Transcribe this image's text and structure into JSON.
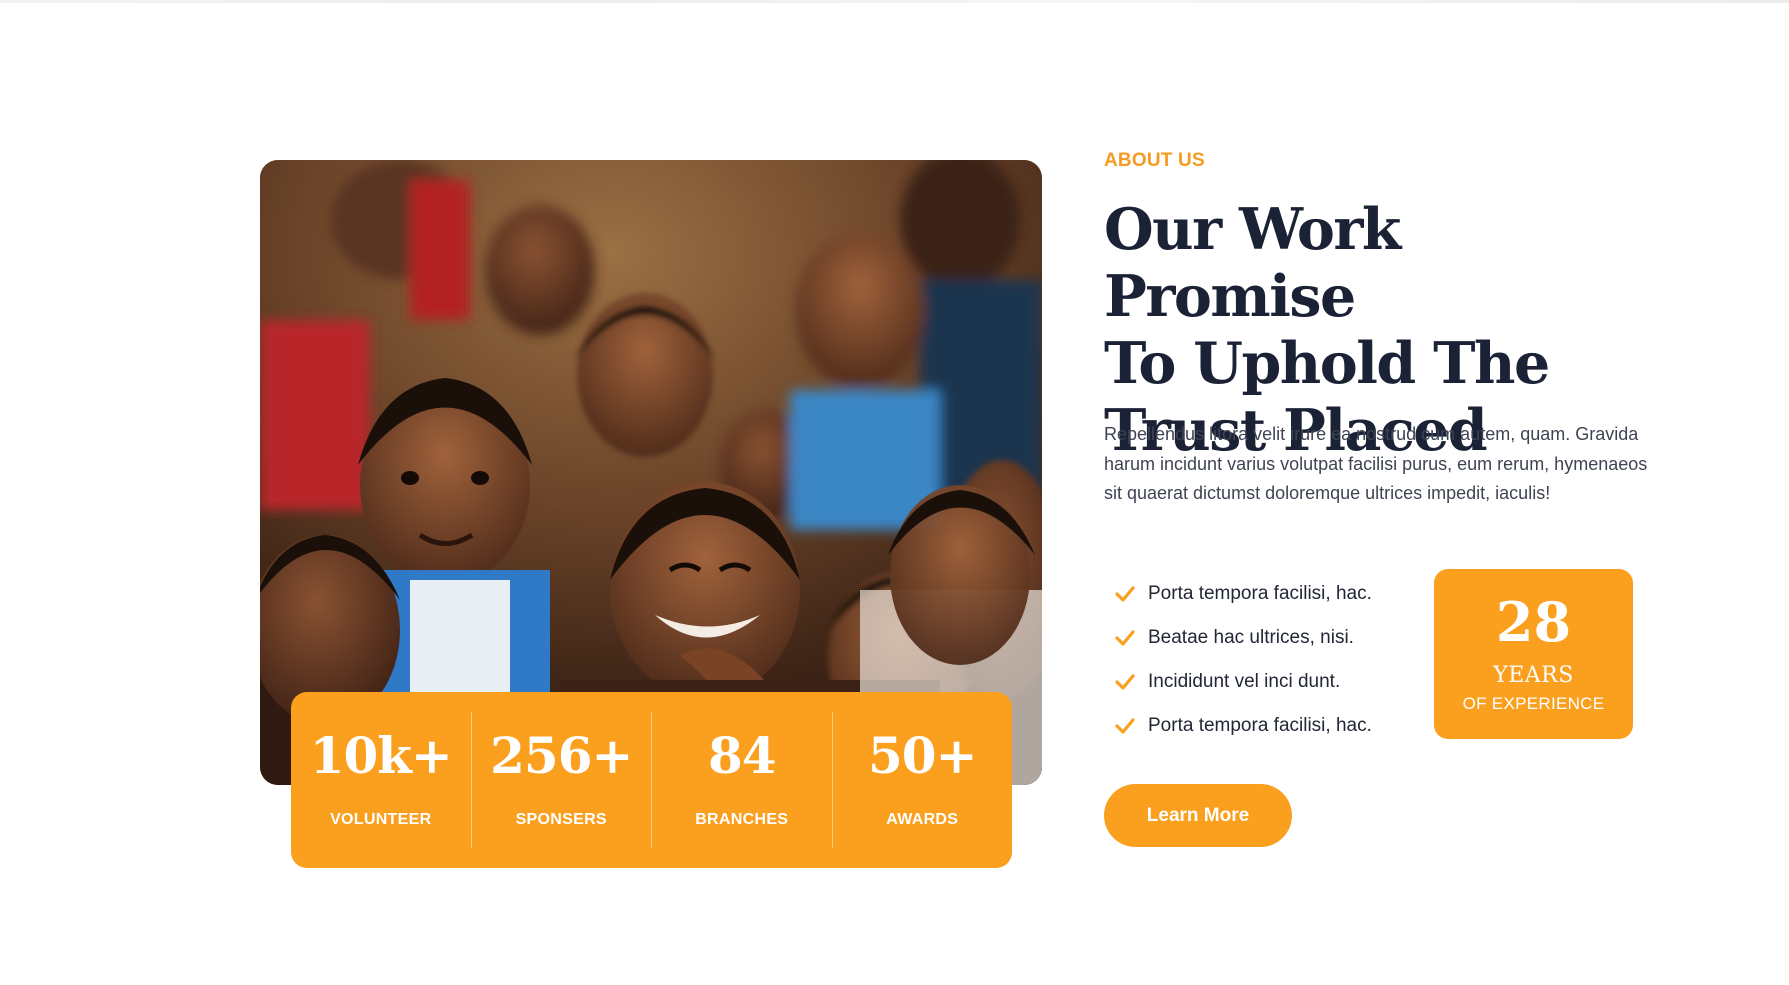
{
  "about": {
    "eyebrow": "ABOUT US",
    "headline_lines": [
      "Our Work Promise",
      "To Uphold The",
      "Trust Placed"
    ],
    "lead": "Repellendus litora velit irure ea nostrud cum autem, quam. Gravida harum incidunt varius volutpat facilisi purus, eum rerum, hymenaeos sit quaerat dictumst doloremque ultrices impedit, iaculis!",
    "checklist": [
      "Porta tempora facilisi, hac.",
      "Beatae hac ultrices, nisi.",
      "Incididunt vel inci dunt.",
      "Porta tempora facilisi, hac."
    ],
    "button_label": "Learn More"
  },
  "experience": {
    "number": "28",
    "years_label": "YEARS",
    "sub_label": "OF EXPERIENCE"
  },
  "stats": [
    {
      "value": "10k+",
      "label": "VOLUNTEER"
    },
    {
      "value": "256+",
      "label": "SPONSERS"
    },
    {
      "value": "84",
      "label": "BRANCHES"
    },
    {
      "value": "50+",
      "label": "AWARDS"
    }
  ],
  "colors": {
    "accent": "#fb9f1f",
    "heading": "#1b2236",
    "body_text": "#3f4452"
  },
  "icons": {
    "check": "checkmark-icon"
  }
}
